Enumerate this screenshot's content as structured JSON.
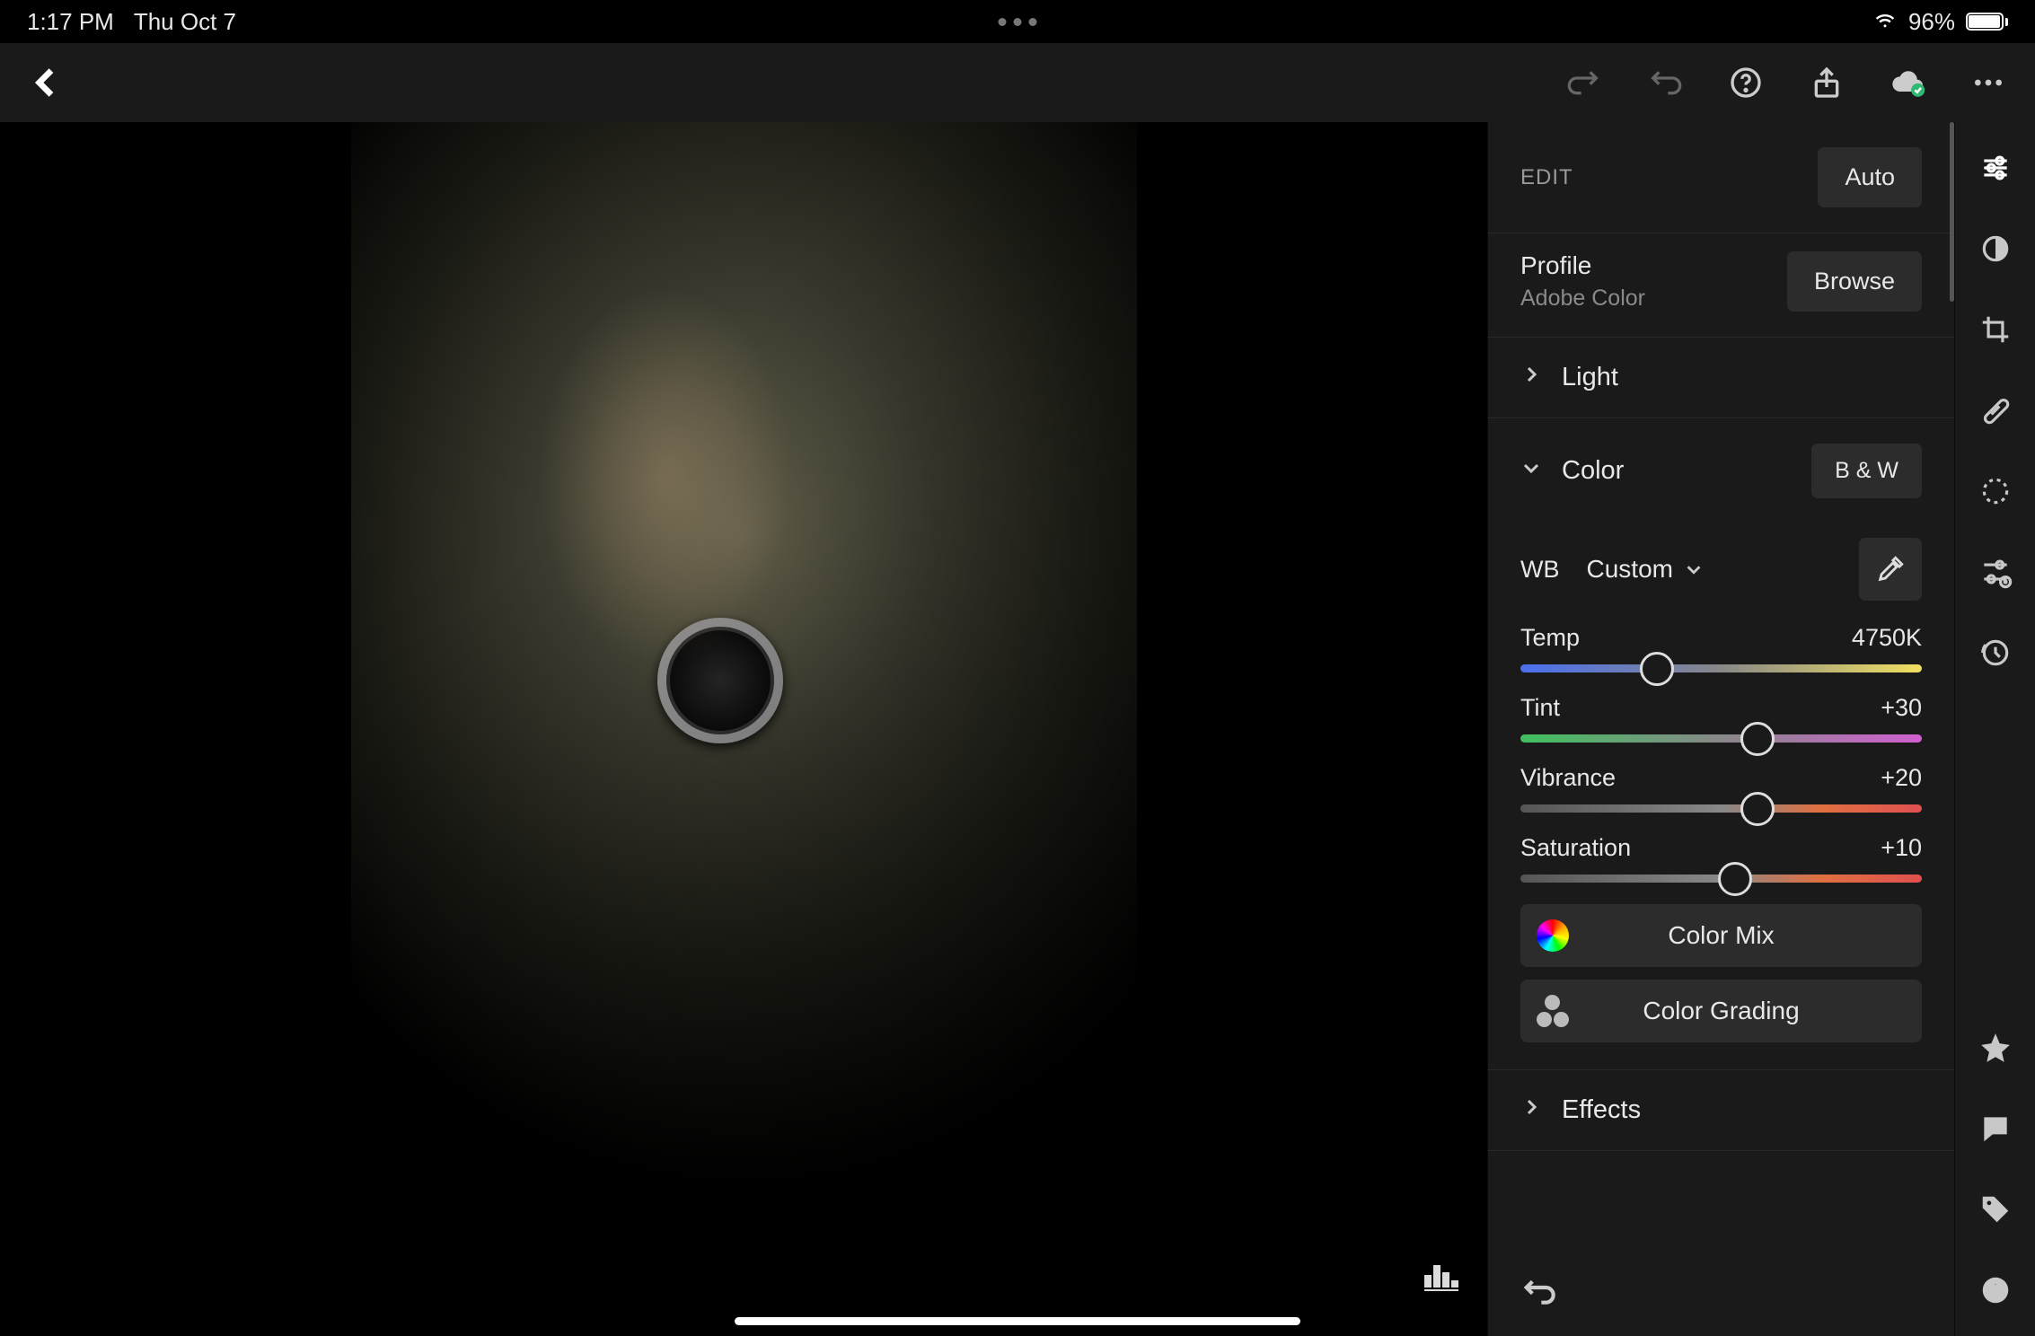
{
  "status": {
    "time": "1:17 PM",
    "date": "Thu Oct 7",
    "battery": "96%"
  },
  "toolbar": {},
  "edit": {
    "title": "EDIT",
    "auto_label": "Auto",
    "profile_label": "Profile",
    "profile_value": "Adobe Color",
    "browse_label": "Browse"
  },
  "sections": {
    "light_label": "Light",
    "color_label": "Color",
    "bw_label": "B & W",
    "effects_label": "Effects"
  },
  "color": {
    "wb_label": "WB",
    "wb_value": "Custom",
    "sliders": {
      "temp": {
        "label": "Temp",
        "value": "4750K",
        "pos": 34
      },
      "tint": {
        "label": "Tint",
        "value": "+30",
        "pos": 59
      },
      "vibrance": {
        "label": "Vibrance",
        "value": "+20",
        "pos": 59
      },
      "saturation": {
        "label": "Saturation",
        "value": "+10",
        "pos": 53.5
      }
    },
    "mix_label": "Color Mix",
    "grading_label": "Color Grading"
  }
}
